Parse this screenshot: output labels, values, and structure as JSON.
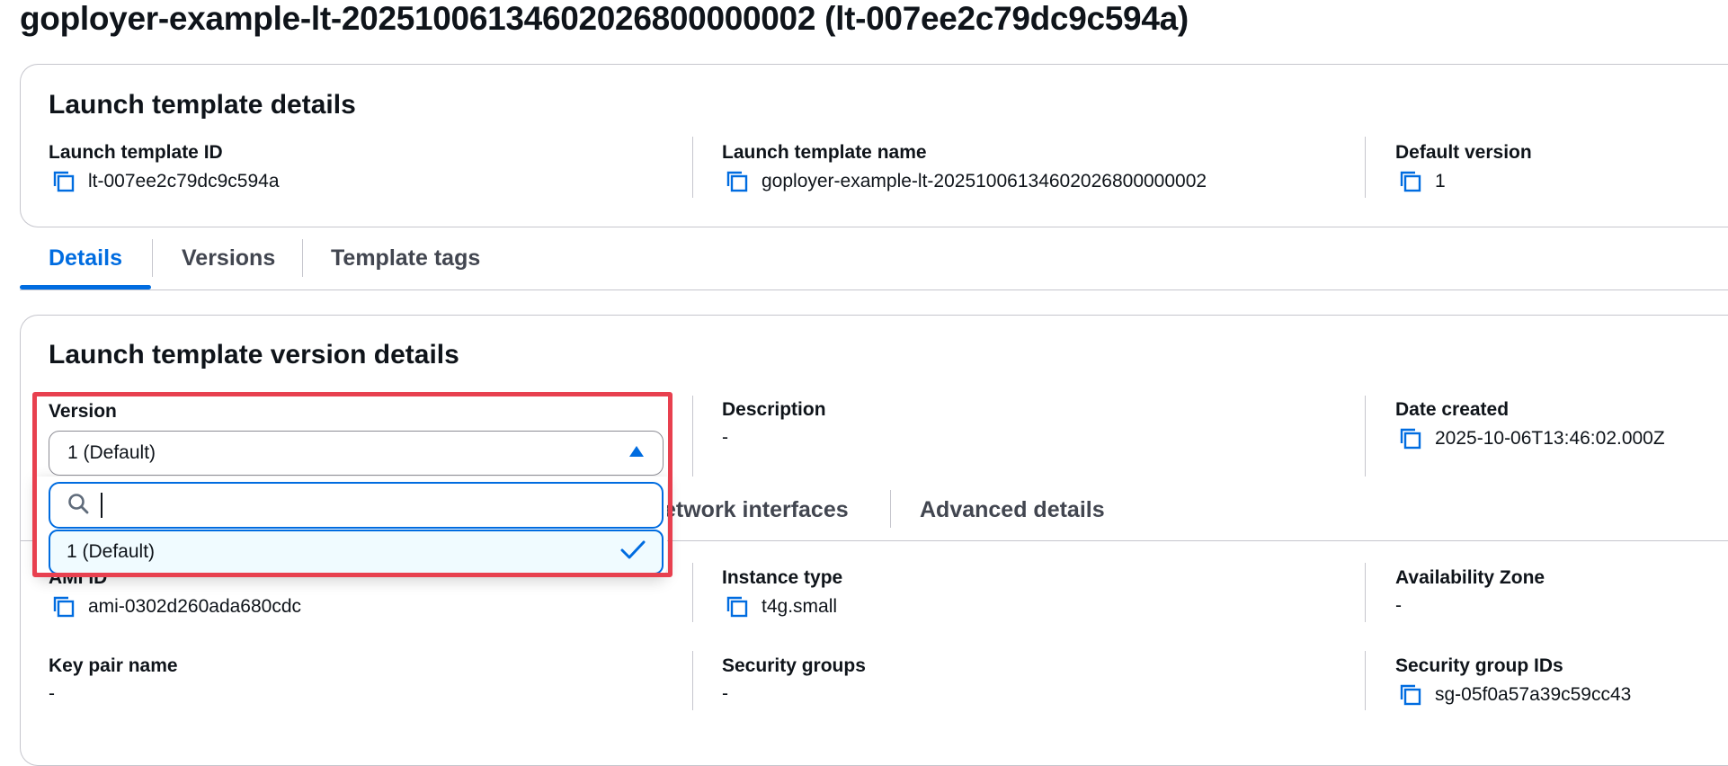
{
  "page": {
    "title": "goployer-example-lt-20251006134602026800000002 (lt-007ee2c79dc9c594a)"
  },
  "template_details": {
    "header": "Launch template details",
    "fields": [
      {
        "label": "Launch template ID",
        "value": "lt-007ee2c79dc9c594a"
      },
      {
        "label": "Launch template name",
        "value": "goployer-example-lt-20251006134602026800000002"
      },
      {
        "label": "Default version",
        "value": "1"
      }
    ]
  },
  "tabs": [
    {
      "label": "Details",
      "active": true
    },
    {
      "label": "Versions",
      "active": false
    },
    {
      "label": "Template tags",
      "active": false
    }
  ],
  "version_details": {
    "header": "Launch template version details",
    "version": {
      "label": "Version",
      "selected": "1 (Default)",
      "search_value": "",
      "options": [
        {
          "label": "1 (Default)",
          "selected": true
        }
      ]
    },
    "description": {
      "label": "Description",
      "value": "-"
    },
    "date_created": {
      "label": "Date created",
      "value": "2025-10-06T13:46:02.000Z"
    },
    "inner_tabs": [
      {
        "label": "etwork interfaces"
      },
      {
        "label": "Advanced details"
      }
    ],
    "fields": [
      {
        "label": "AMI ID",
        "value": "ami-0302d260ada680cdc"
      },
      {
        "label": "Instance type",
        "value": "t4g.small"
      },
      {
        "label": "Availability Zone",
        "value": "-"
      },
      {
        "label": "Key pair name",
        "value": "-"
      },
      {
        "label": "Security groups",
        "value": "-"
      },
      {
        "label": "Security group IDs",
        "value": "sg-05f0a57a39c59cc43"
      }
    ]
  },
  "colors": {
    "accent": "#006ce0",
    "highlight": "#e8404f",
    "text": "#0f141a",
    "border": "#c6c6cd"
  },
  "icons": {
    "copy": "copy-icon",
    "search": "search-icon",
    "caret": "caret-up-icon",
    "check": "check-icon"
  }
}
